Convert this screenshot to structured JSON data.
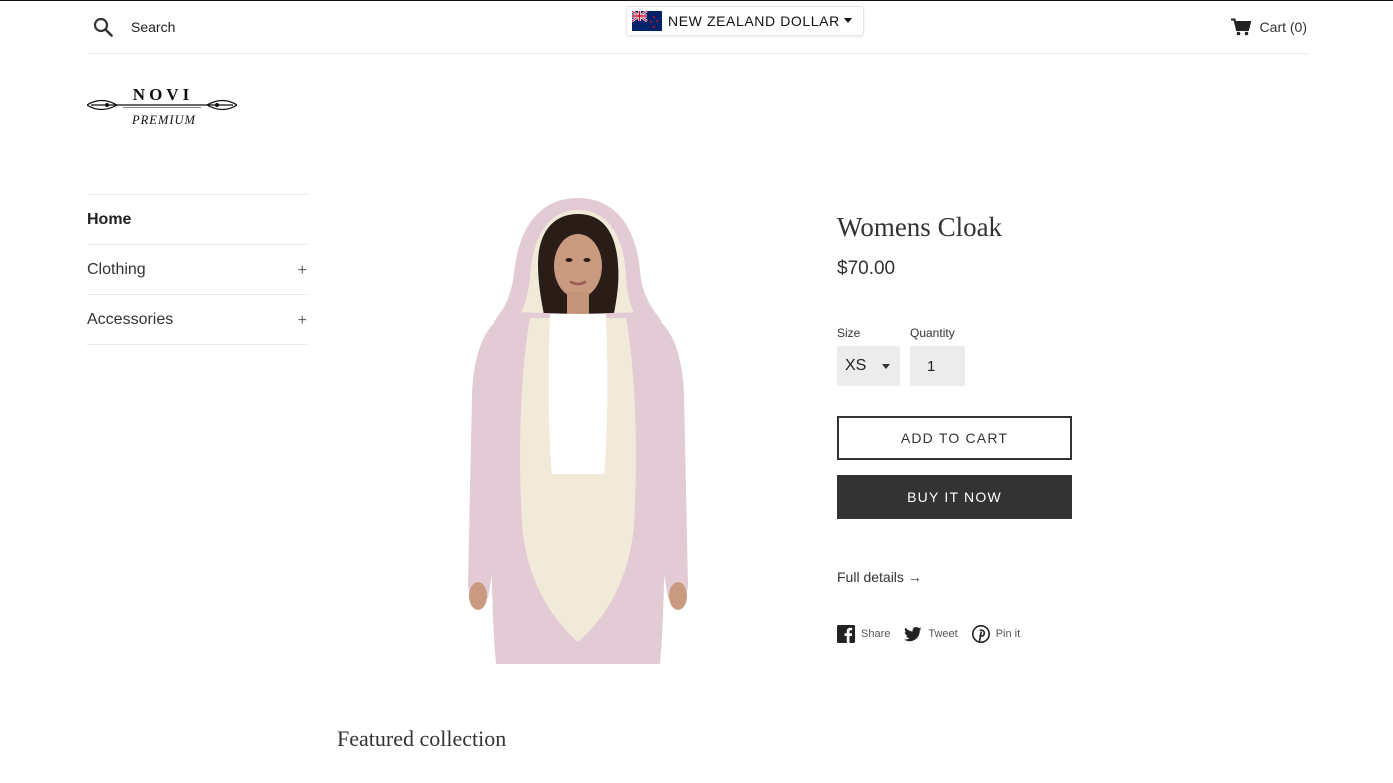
{
  "header": {
    "search_placeholder": "Search",
    "currency": "NEW ZEALAND DOLLAR",
    "cart_label": "Cart (0)"
  },
  "logo": {
    "brand": "NOVI",
    "tagline": "PREMIUM"
  },
  "sidebar": {
    "items": [
      {
        "label": "Home",
        "expandable": false,
        "active": true
      },
      {
        "label": "Clothing",
        "expandable": true,
        "toggle": "+"
      },
      {
        "label": "Accessories",
        "expandable": true,
        "toggle": "+"
      }
    ]
  },
  "product": {
    "title": "Womens Cloak",
    "price": "$70.00",
    "size_label": "Size",
    "size_value": "XS",
    "quantity_label": "Quantity",
    "quantity_value": "1",
    "add_to_cart": "ADD TO CART",
    "buy_now": "BUY IT NOW",
    "full_details": "Full details →",
    "share": {
      "facebook": "Share",
      "twitter": "Tweet",
      "pinterest": "Pin it"
    }
  },
  "featured_collection": "Featured collection",
  "colors": {
    "cloak": "#e3cbd6",
    "lining": "#f2ead9",
    "button_dark": "#333333",
    "field_bg": "#ececec"
  },
  "icons": [
    "search-icon",
    "nz-flag-icon",
    "cart-icon",
    "facebook-icon",
    "twitter-icon",
    "pinterest-icon"
  ]
}
